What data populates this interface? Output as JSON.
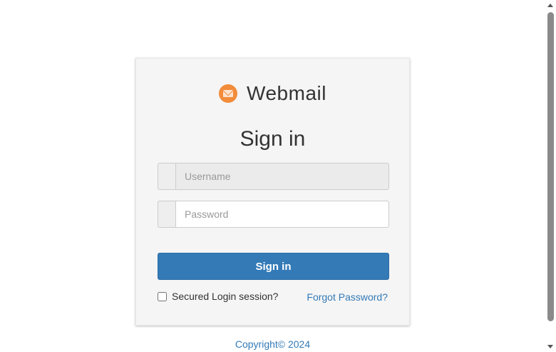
{
  "brand": {
    "title": "Webmail",
    "icon": "envelope-logo-icon",
    "icon_color": "#f28c3a"
  },
  "form": {
    "heading": "Sign in",
    "username_placeholder": "Username",
    "password_placeholder": "Password",
    "submit_label": "Sign in",
    "secured_login_label": "Secured Login session?",
    "forgot_password_label": "Forgot Password?"
  },
  "footer": {
    "copyright": "Copyright© 2024"
  },
  "colors": {
    "primary": "#337ab7",
    "card_bg": "#f5f5f5"
  }
}
